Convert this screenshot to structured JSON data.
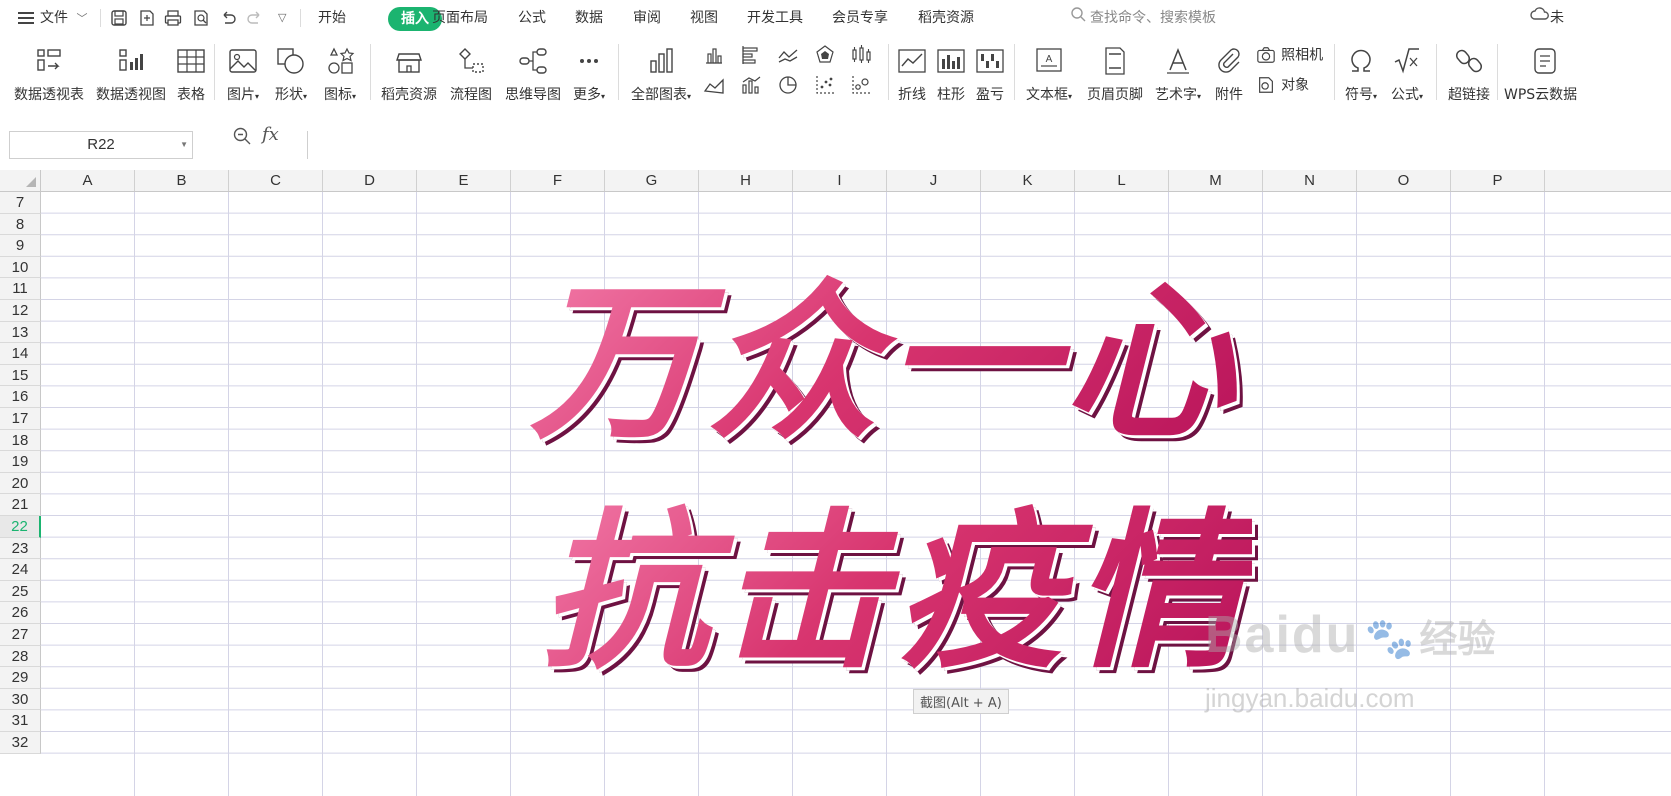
{
  "menubar": {
    "file_label": "文件",
    "tabs": [
      "开始",
      "插入",
      "页面布局",
      "公式",
      "数据",
      "审阅",
      "视图",
      "开发工具",
      "会员专享",
      "稻壳资源"
    ],
    "active_tab": "插入",
    "search_placeholder": "查找命令、搜索模板",
    "cloud_label": "未"
  },
  "ribbon": {
    "items": [
      {
        "label": "数据透视表",
        "icon": "pivot-table-icon"
      },
      {
        "label": "数据透视图",
        "icon": "pivot-chart-icon"
      },
      {
        "label": "表格",
        "icon": "table-icon"
      },
      {
        "label": "图片",
        "icon": "picture-icon"
      },
      {
        "label": "形状",
        "icon": "shape-icon"
      },
      {
        "label": "图标",
        "icon": "icons-icon"
      },
      {
        "label": "稻壳资源",
        "icon": "docer-icon"
      },
      {
        "label": "流程图",
        "icon": "flowchart-icon"
      },
      {
        "label": "思维导图",
        "icon": "mindmap-icon"
      },
      {
        "label": "更多",
        "icon": "more-icon"
      },
      {
        "label": "全部图表",
        "icon": "all-charts-icon"
      },
      {
        "label": "折线",
        "icon": "sparkline-line-icon"
      },
      {
        "label": "柱形",
        "icon": "sparkline-column-icon"
      },
      {
        "label": "盈亏",
        "icon": "sparkline-winloss-icon"
      },
      {
        "label": "文本框",
        "icon": "textbox-icon"
      },
      {
        "label": "页眉页脚",
        "icon": "header-footer-icon"
      },
      {
        "label": "艺术字",
        "icon": "wordart-icon"
      },
      {
        "label": "附件",
        "icon": "attachment-icon"
      },
      {
        "label": "符号",
        "icon": "symbol-icon"
      },
      {
        "label": "公式",
        "icon": "equation-icon"
      },
      {
        "label": "超链接",
        "icon": "hyperlink-icon"
      },
      {
        "label": "WPS云数据",
        "icon": "cloud-data-icon"
      }
    ],
    "camera_label": "照相机",
    "object_label": "对象"
  },
  "formula_bar": {
    "name_box": "R22",
    "fx_label": "fx",
    "formula": ""
  },
  "sheet": {
    "columns": [
      "A",
      "B",
      "C",
      "D",
      "E",
      "F",
      "G",
      "H",
      "I",
      "J",
      "K",
      "L",
      "M",
      "N",
      "O",
      "P"
    ],
    "rows": [
      "7",
      "8",
      "9",
      "10",
      "11",
      "12",
      "13",
      "14",
      "15",
      "16",
      "17",
      "18",
      "19",
      "20",
      "21",
      "22",
      "23",
      "24",
      "25",
      "26",
      "27",
      "28",
      "29",
      "30",
      "31",
      "32"
    ],
    "active_row": "22"
  },
  "wordart": {
    "line1": "万众一心",
    "line2": "抗击疫情",
    "colors": {
      "light": "#f27aa8",
      "mid": "#d8356f",
      "dark": "#b8135a",
      "shadow": "#6e1242"
    }
  },
  "tooltip": "截图(Alt + A)",
  "watermark": {
    "brand": "Baidu",
    "cn": "经验",
    "url": "jingyan.baidu.com"
  },
  "accent_color": "#1bb470"
}
